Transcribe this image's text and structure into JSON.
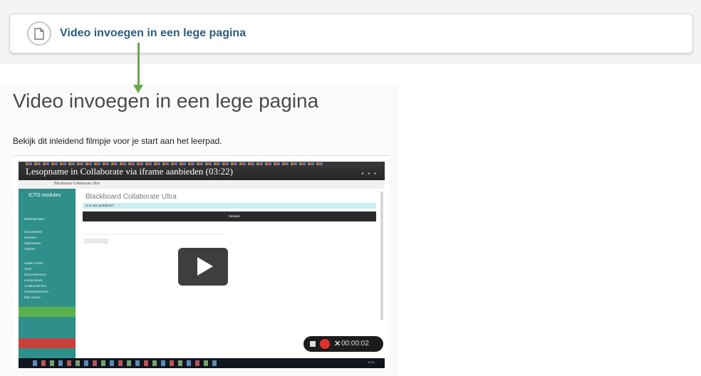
{
  "card": {
    "title": "Video invoegen in een lege pagina",
    "icon": "document-icon"
  },
  "colors": {
    "accent": "#2f5d7e",
    "arrow": "#6aa84f"
  },
  "page": {
    "heading": "Video invoegen in een lege pagina",
    "intro": "Bekijk dit inleidend filmpje voor je start aan het leerpad."
  },
  "video": {
    "title": "Lesopname in Collaborate via iframe aanbieden (03:22)",
    "app_url": "Blackboard Collaborate Ultra",
    "sidebar_logo": "ICTO modules",
    "sidebar_items": [
      "Mededelingen",
      "Documenten",
      "Modules",
      "Opdrachten",
      "Toetsen",
      "Grade Center",
      "Tools",
      "Discussieforum",
      "Lesopnames",
      "Collaborate live",
      "Contactpersonen",
      "Mijn cursus"
    ],
    "bb_title": "Blackboard Collaborate Ultra",
    "alert": "Is er een probleem?",
    "dark_bar": "Sessies",
    "recorder_time": "00:00:02",
    "clock": "11:21"
  }
}
